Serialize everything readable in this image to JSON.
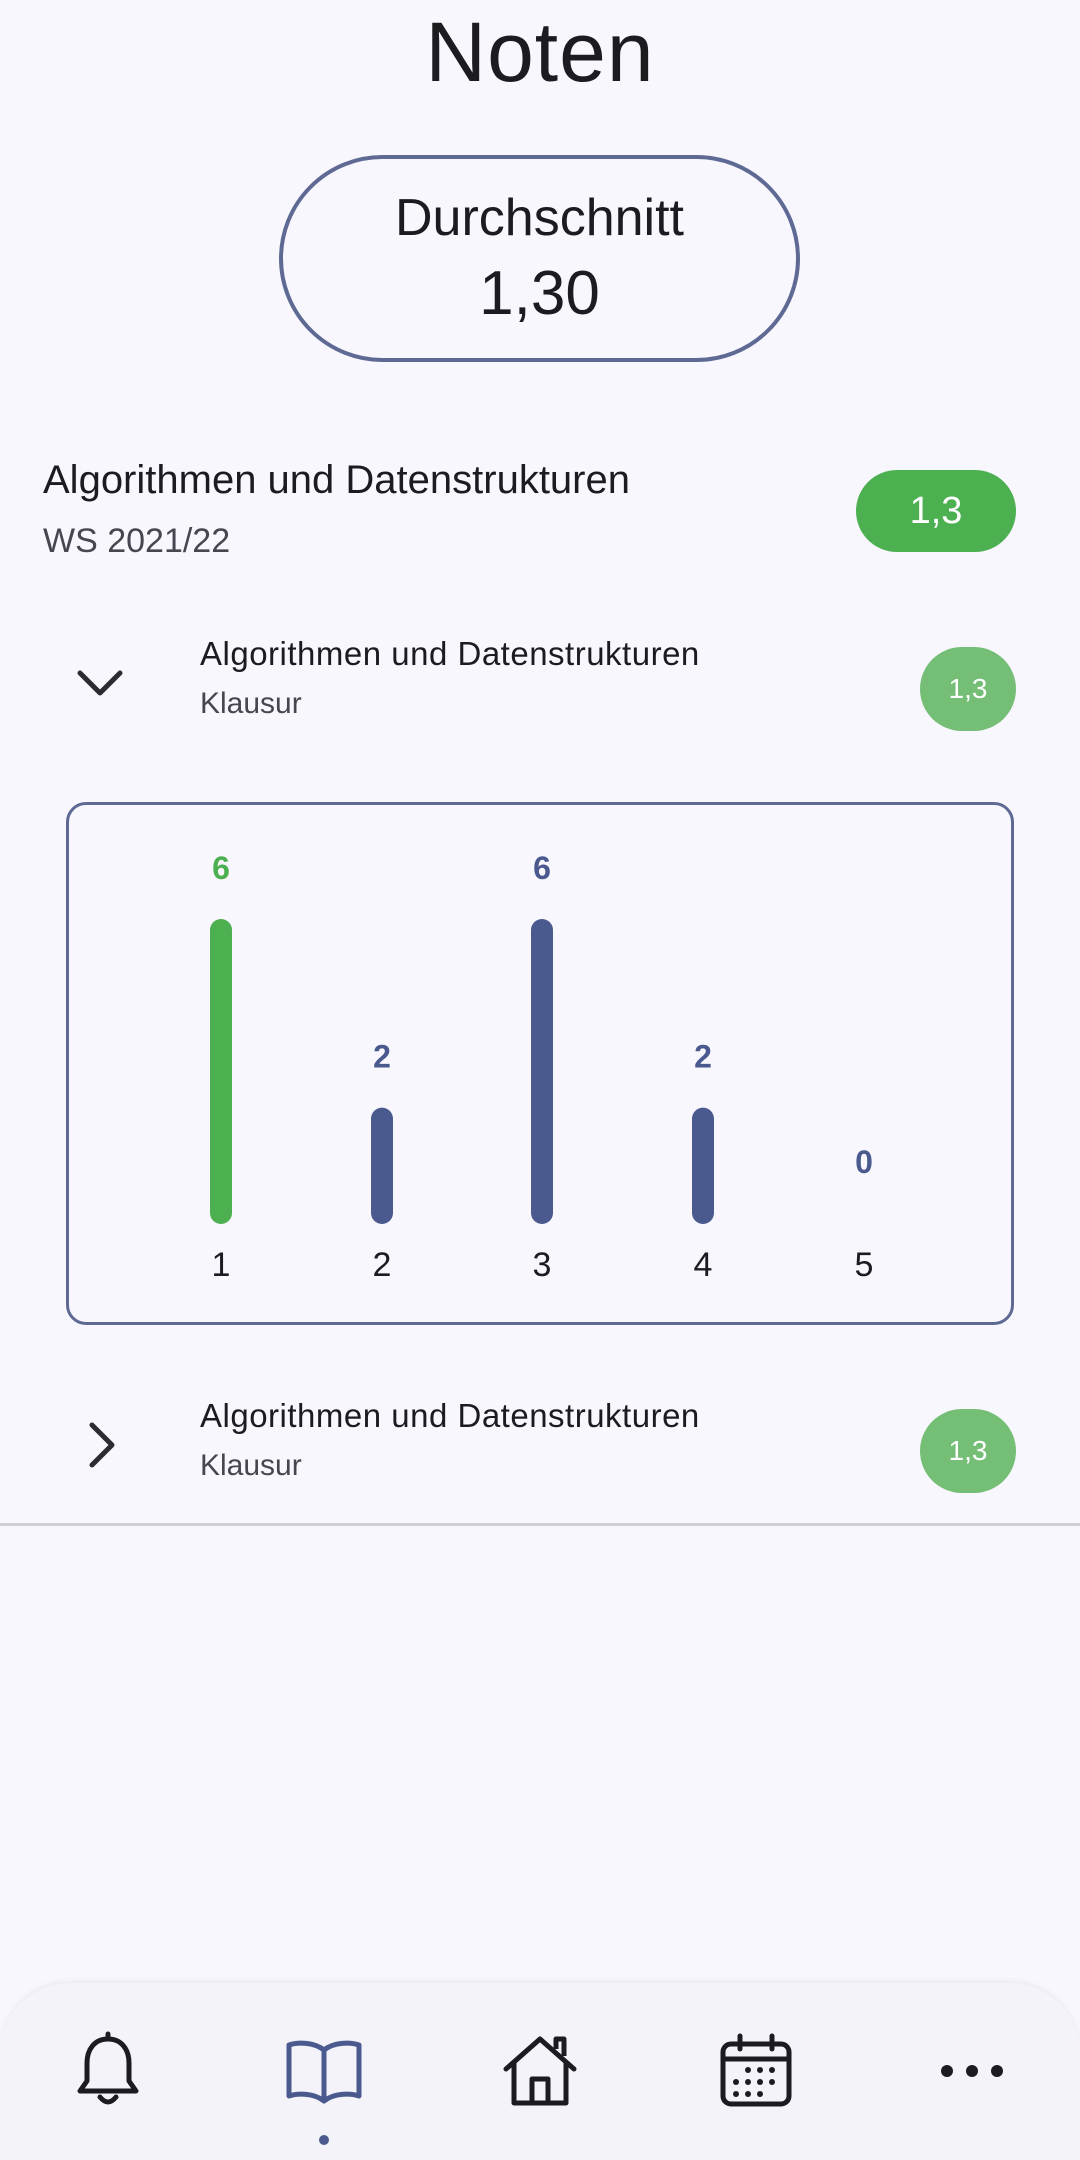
{
  "page": {
    "title": "Noten"
  },
  "average": {
    "label": "Durchschnitt",
    "value": "1,30"
  },
  "module": {
    "title": "Algorithmen und Datenstrukturen",
    "semester": "WS 2021/22",
    "grade": "1,3"
  },
  "exams": [
    {
      "title": "Algorithmen und Datenstrukturen",
      "type": "Klausur",
      "grade": "1,3",
      "expanded": true
    },
    {
      "title": "Algorithmen und Datenstrukturen",
      "type": "Klausur",
      "grade": "1,3",
      "expanded": false
    }
  ],
  "colors": {
    "accent": "#4a5a8e",
    "success": "#4caf50",
    "success_light": "#74be76",
    "outline": "#5f6a94"
  },
  "chart_data": {
    "type": "bar",
    "categories": [
      "1",
      "2",
      "3",
      "4",
      "5"
    ],
    "values": [
      6,
      2,
      6,
      2,
      0
    ],
    "highlight_index": 0,
    "highlight_color": "#4caf50",
    "bar_color": "#4a5a8e",
    "ylim": [
      0,
      6
    ],
    "title": "",
    "xlabel": "",
    "ylabel": ""
  },
  "bottom_nav": {
    "items": [
      {
        "icon": "bell-icon",
        "active": false
      },
      {
        "icon": "book-icon",
        "active": true
      },
      {
        "icon": "home-icon",
        "active": false
      },
      {
        "icon": "calendar-icon",
        "active": false
      },
      {
        "icon": "more-icon",
        "active": false
      }
    ]
  }
}
